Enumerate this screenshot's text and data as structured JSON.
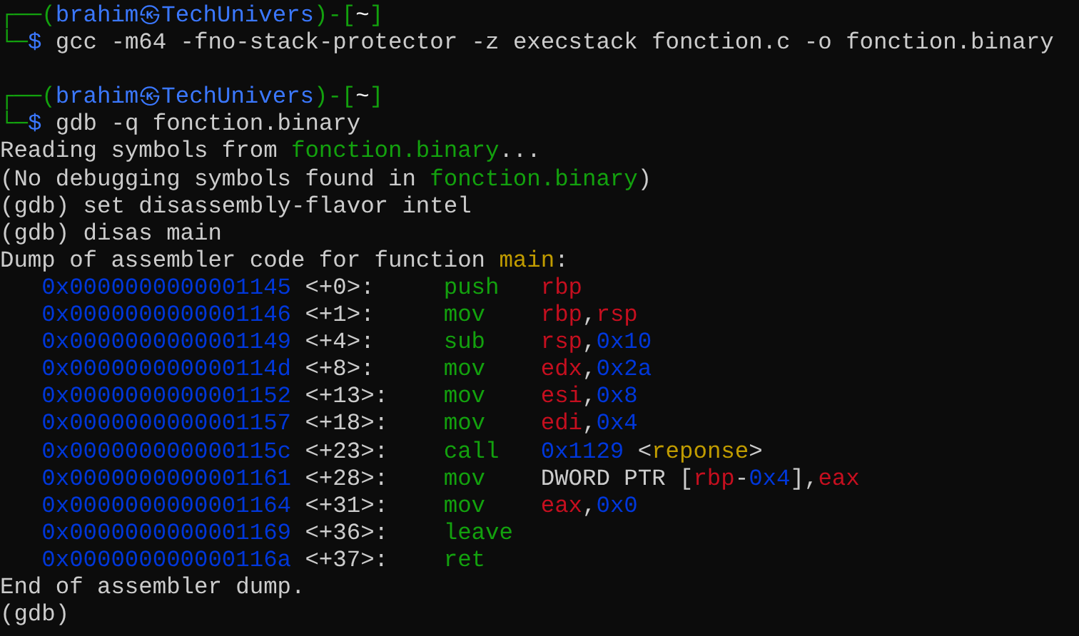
{
  "blocks": [
    {
      "lines": [
        {
          "segments": [
            {
              "text": "┌──(",
              "color": "#13a10e"
            },
            {
              "text": "brahim㉿TechUnivers",
              "color": "#3b78ff"
            },
            {
              "text": ")-[",
              "color": "#13a10e"
            },
            {
              "text": "~",
              "color": "#f2f2f2"
            },
            {
              "text": "]",
              "color": "#13a10e"
            }
          ]
        },
        {
          "segments": [
            {
              "text": "└─",
              "color": "#13a10e"
            },
            {
              "text": "$ ",
              "color": "#3b78ff"
            },
            {
              "text": "gcc -m64 -fno-stack-protector -z execstack fonction.c -o fonction.binary",
              "color": "#cccccc"
            }
          ]
        }
      ]
    },
    {
      "lines": [
        {
          "segments": [
            {
              "text": "┌──(",
              "color": "#13a10e"
            },
            {
              "text": "brahim㉿TechUnivers",
              "color": "#3b78ff"
            },
            {
              "text": ")-[",
              "color": "#13a10e"
            },
            {
              "text": "~",
              "color": "#f2f2f2"
            },
            {
              "text": "]",
              "color": "#13a10e"
            }
          ]
        },
        {
          "segments": [
            {
              "text": "└─",
              "color": "#13a10e"
            },
            {
              "text": "$ ",
              "color": "#3b78ff"
            },
            {
              "text": "gdb -q fonction.binary",
              "color": "#cccccc"
            }
          ]
        },
        {
          "segments": [
            {
              "text": "Reading symbols from ",
              "color": "#cccccc"
            },
            {
              "text": "fonction.binary",
              "color": "#13a10e"
            },
            {
              "text": "...",
              "color": "#cccccc"
            }
          ]
        },
        {
          "segments": [
            {
              "text": "(No debugging symbols found in ",
              "color": "#cccccc"
            },
            {
              "text": "fonction.binary",
              "color": "#13a10e"
            },
            {
              "text": ")",
              "color": "#cccccc"
            }
          ]
        },
        {
          "segments": [
            {
              "text": "(gdb) set disassembly-flavor intel",
              "color": "#cccccc"
            }
          ]
        },
        {
          "segments": [
            {
              "text": "(gdb) disas main",
              "color": "#cccccc"
            }
          ]
        },
        {
          "segments": [
            {
              "text": "Dump of assembler code for function ",
              "color": "#cccccc"
            },
            {
              "text": "main",
              "color": "#c19c00"
            },
            {
              "text": ":",
              "color": "#cccccc"
            }
          ]
        },
        {
          "segments": [
            {
              "text": "   0x0000000000001145",
              "color": "#0037da"
            },
            {
              "text": " <+0>:     ",
              "color": "#cccccc"
            },
            {
              "text": "push   ",
              "color": "#13a10e"
            },
            {
              "text": "rbp",
              "color": "#c50f1f"
            }
          ]
        },
        {
          "segments": [
            {
              "text": "   0x0000000000001146",
              "color": "#0037da"
            },
            {
              "text": " <+1>:     ",
              "color": "#cccccc"
            },
            {
              "text": "mov    ",
              "color": "#13a10e"
            },
            {
              "text": "rbp",
              "color": "#c50f1f"
            },
            {
              "text": ",",
              "color": "#cccccc"
            },
            {
              "text": "rsp",
              "color": "#c50f1f"
            }
          ]
        },
        {
          "segments": [
            {
              "text": "   0x0000000000001149",
              "color": "#0037da"
            },
            {
              "text": " <+4>:     ",
              "color": "#cccccc"
            },
            {
              "text": "sub    ",
              "color": "#13a10e"
            },
            {
              "text": "rsp",
              "color": "#c50f1f"
            },
            {
              "text": ",",
              "color": "#cccccc"
            },
            {
              "text": "0x10",
              "color": "#0037da"
            }
          ]
        },
        {
          "segments": [
            {
              "text": "   0x000000000000114d",
              "color": "#0037da"
            },
            {
              "text": " <+8>:     ",
              "color": "#cccccc"
            },
            {
              "text": "mov    ",
              "color": "#13a10e"
            },
            {
              "text": "edx",
              "color": "#c50f1f"
            },
            {
              "text": ",",
              "color": "#cccccc"
            },
            {
              "text": "0x2a",
              "color": "#0037da"
            }
          ]
        },
        {
          "segments": [
            {
              "text": "   0x0000000000001152",
              "color": "#0037da"
            },
            {
              "text": " <+13>:    ",
              "color": "#cccccc"
            },
            {
              "text": "mov    ",
              "color": "#13a10e"
            },
            {
              "text": "esi",
              "color": "#c50f1f"
            },
            {
              "text": ",",
              "color": "#cccccc"
            },
            {
              "text": "0x8",
              "color": "#0037da"
            }
          ]
        },
        {
          "segments": [
            {
              "text": "   0x0000000000001157",
              "color": "#0037da"
            },
            {
              "text": " <+18>:    ",
              "color": "#cccccc"
            },
            {
              "text": "mov    ",
              "color": "#13a10e"
            },
            {
              "text": "edi",
              "color": "#c50f1f"
            },
            {
              "text": ",",
              "color": "#cccccc"
            },
            {
              "text": "0x4",
              "color": "#0037da"
            }
          ]
        },
        {
          "segments": [
            {
              "text": "   0x000000000000115c",
              "color": "#0037da"
            },
            {
              "text": " <+23>:    ",
              "color": "#cccccc"
            },
            {
              "text": "call   ",
              "color": "#13a10e"
            },
            {
              "text": "0x1129",
              "color": "#0037da"
            },
            {
              "text": " <",
              "color": "#cccccc"
            },
            {
              "text": "reponse",
              "color": "#c19c00"
            },
            {
              "text": ">",
              "color": "#cccccc"
            }
          ]
        },
        {
          "segments": [
            {
              "text": "   0x0000000000001161",
              "color": "#0037da"
            },
            {
              "text": " <+28>:    ",
              "color": "#cccccc"
            },
            {
              "text": "mov    ",
              "color": "#13a10e"
            },
            {
              "text": "DWORD PTR [",
              "color": "#cccccc"
            },
            {
              "text": "rbp",
              "color": "#c50f1f"
            },
            {
              "text": "-",
              "color": "#cccccc"
            },
            {
              "text": "0x4",
              "color": "#0037da"
            },
            {
              "text": "],",
              "color": "#cccccc"
            },
            {
              "text": "eax",
              "color": "#c50f1f"
            }
          ]
        },
        {
          "segments": [
            {
              "text": "   0x0000000000001164",
              "color": "#0037da"
            },
            {
              "text": " <+31>:    ",
              "color": "#cccccc"
            },
            {
              "text": "mov    ",
              "color": "#13a10e"
            },
            {
              "text": "eax",
              "color": "#c50f1f"
            },
            {
              "text": ",",
              "color": "#cccccc"
            },
            {
              "text": "0x0",
              "color": "#0037da"
            }
          ]
        },
        {
          "segments": [
            {
              "text": "   0x0000000000001169",
              "color": "#0037da"
            },
            {
              "text": " <+36>:    ",
              "color": "#cccccc"
            },
            {
              "text": "leave",
              "color": "#13a10e"
            }
          ]
        },
        {
          "segments": [
            {
              "text": "   0x000000000000116a",
              "color": "#0037da"
            },
            {
              "text": " <+37>:    ",
              "color": "#cccccc"
            },
            {
              "text": "ret",
              "color": "#13a10e"
            }
          ]
        },
        {
          "segments": [
            {
              "text": "End of assembler dump.",
              "color": "#cccccc"
            }
          ]
        },
        {
          "segments": [
            {
              "text": "(gdb)",
              "color": "#cccccc"
            }
          ]
        }
      ]
    }
  ]
}
